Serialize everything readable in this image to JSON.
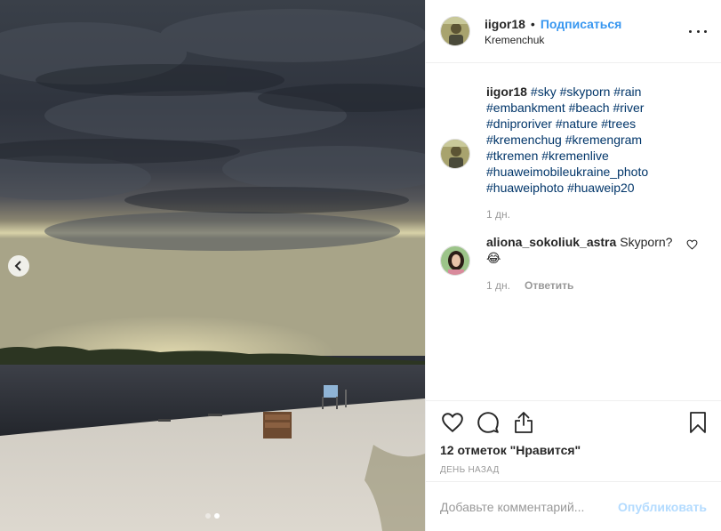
{
  "post": {
    "author": "iigor18",
    "separator": "•",
    "follow_label": "Подписаться",
    "location": "Kremenchuk"
  },
  "caption": {
    "author": "iigor18",
    "hashtags": [
      "#sky",
      "#skyporn",
      "#rain",
      "#embankment",
      "#beach",
      "#river",
      "#dniproriver",
      "#nature",
      "#trees",
      "#kremenchug",
      "#kremengram",
      "#tkremen",
      "#kremenlive",
      "#huaweimobileukraine_photo",
      "#huaweiphoto",
      "#huaweip20"
    ],
    "time": "1 дн."
  },
  "comment": {
    "author": "aliona_sokoliuk_astra",
    "text": "Skyporn?",
    "emoji": "😂",
    "time": "1 дн.",
    "reply_label": "Ответить"
  },
  "actions": {
    "likes_text": "12 отметок «Нравится»",
    "likes_count": "12 отметок",
    "likes_word": "\"Нравится\"",
    "posted": "ДЕНЬ НАЗАД"
  },
  "add_comment": {
    "placeholder": "Добавьте комментарий...",
    "publish_label": "Опубликовать"
  },
  "carousel": {
    "current": 2,
    "total": 2
  },
  "colors": {
    "link": "#3897f0",
    "publish_disabled": "#b3dbff",
    "hashtag": "#003569"
  },
  "icons": [
    "chevron-left-icon",
    "more-icon",
    "heart-icon",
    "comment-icon",
    "share-icon",
    "bookmark-icon"
  ]
}
